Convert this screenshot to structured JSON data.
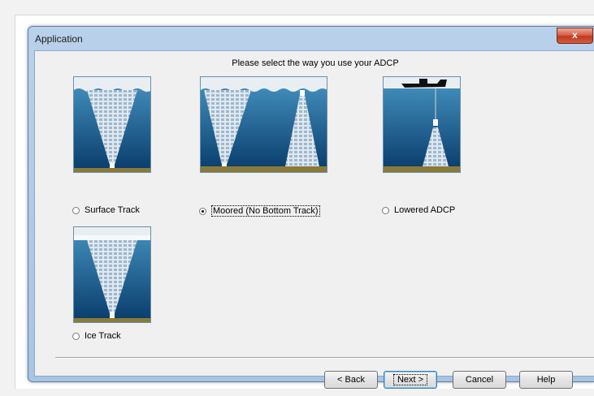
{
  "window": {
    "title": "Application",
    "close_label": "x"
  },
  "prompt": "Please select the way you use your ADCP",
  "options": [
    {
      "label": "Surface Track",
      "selected": false
    },
    {
      "label": "Moored (No Bottom Track)",
      "selected": true
    },
    {
      "label": "Lowered ADCP",
      "selected": false
    },
    {
      "label": "Ice Track",
      "selected": false
    }
  ],
  "buttons": {
    "back": "< Back",
    "next": "Next >",
    "cancel": "Cancel",
    "help": "Help"
  },
  "colors": {
    "water_top": "#3f8ab8",
    "water_bottom": "#0b3f6e",
    "sky": "#e8eef2",
    "seabed": "#8a7a3a"
  }
}
